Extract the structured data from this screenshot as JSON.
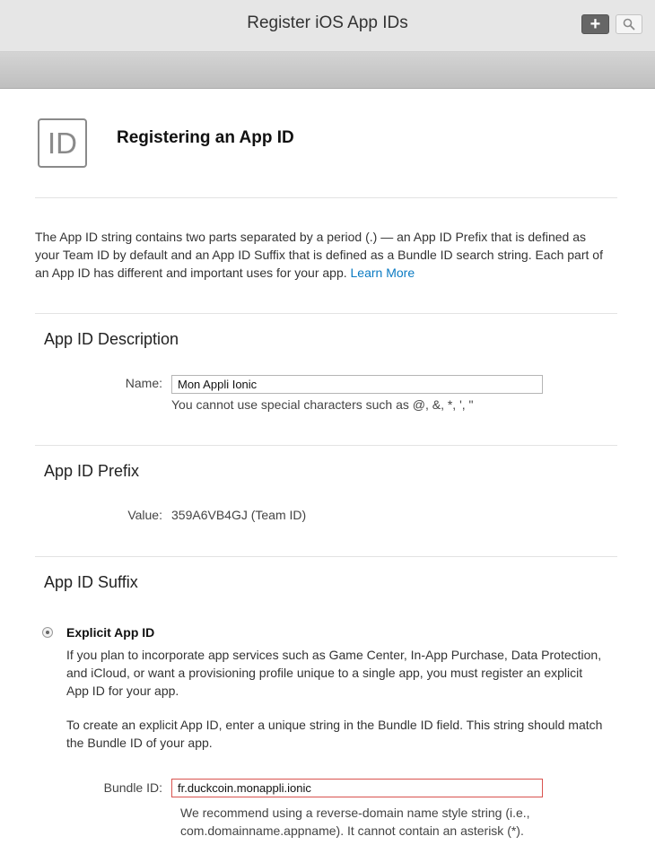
{
  "header": {
    "title": "Register iOS App IDs",
    "add_label": "+"
  },
  "page": {
    "icon_text": "ID",
    "heading": "Registering an App ID",
    "intro_text": "The App ID string contains two parts separated by a period (.) — an App ID Prefix that is defined as your Team ID by default and an App ID Suffix that is defined as a Bundle ID search string. Each part of an App ID has different and important uses for your app. ",
    "learn_more": "Learn More"
  },
  "description_section": {
    "title": "App ID Description",
    "name_label": "Name:",
    "name_value": "Mon Appli Ionic",
    "name_hint": "You cannot use special characters such as @, &, *, ', \""
  },
  "prefix_section": {
    "title": "App ID Prefix",
    "value_label": "Value:",
    "value": "359A6VB4GJ (Team ID)"
  },
  "suffix_section": {
    "title": "App ID Suffix",
    "explicit_title": "Explicit App ID",
    "explicit_para1": "If you plan to incorporate app services such as Game Center, In-App Purchase, Data Protection, and iCloud, or want a provisioning profile unique to a single app, you must register an explicit App ID for your app.",
    "explicit_para2": "To create an explicit App ID, enter a unique string in the Bundle ID field. This string should match the Bundle ID of your app.",
    "bundle_label": "Bundle ID:",
    "bundle_value": "fr.duckcoin.monappli.ionic",
    "bundle_hint": "We recommend using a reverse-domain name style string (i.e., com.domainname.appname). It cannot contain an asterisk (*)."
  },
  "colors": {
    "link": "#0a7ac2",
    "error_border": "#d9534f",
    "topbar_bg": "#e6e6e6"
  }
}
